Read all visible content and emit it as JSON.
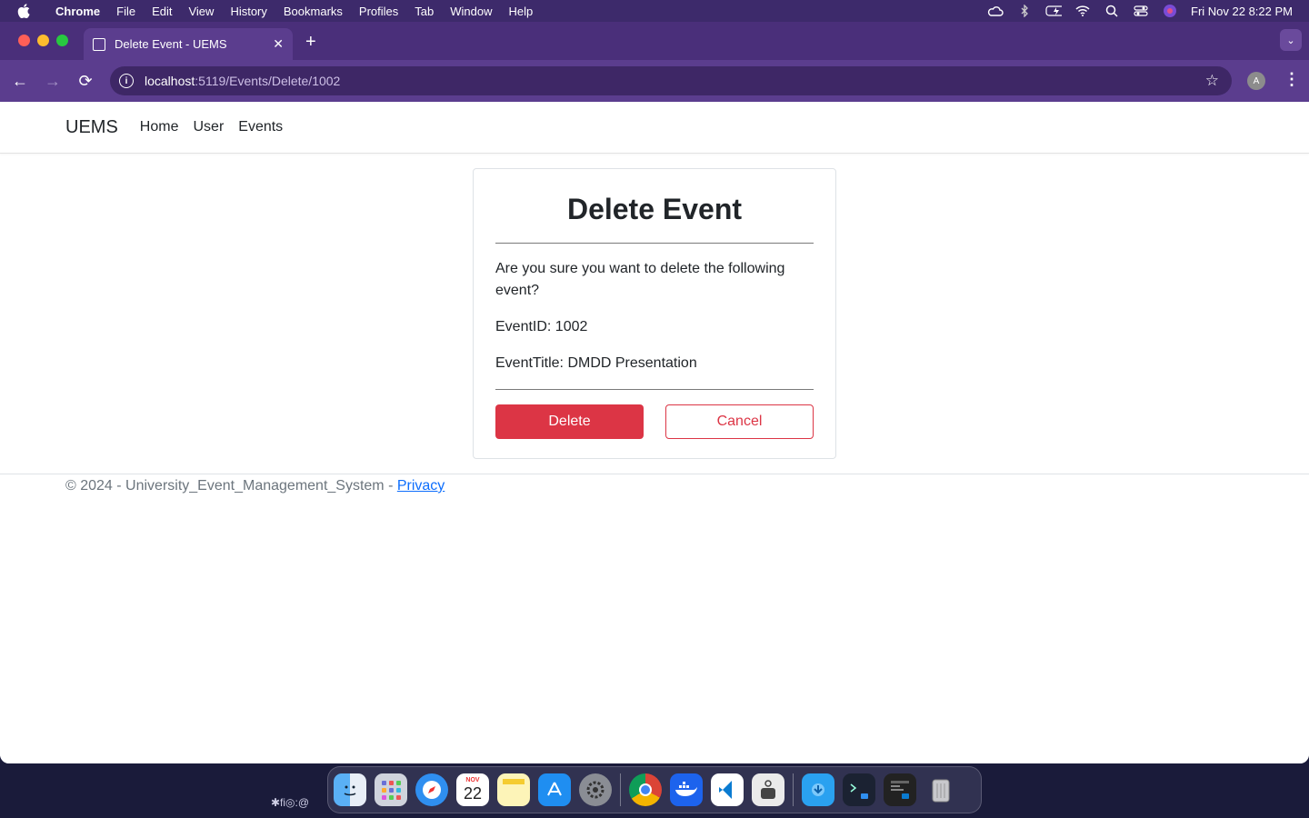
{
  "menubar": {
    "app": "Chrome",
    "items": [
      "File",
      "Edit",
      "View",
      "History",
      "Bookmarks",
      "Profiles",
      "Tab",
      "Window",
      "Help"
    ],
    "clock": "Fri Nov 22  8:22 PM"
  },
  "browser": {
    "tab_title": "Delete Event - UEMS",
    "url_host": "localhost",
    "url_path": ":5119/Events/Delete/1002",
    "avatar_letter": "A"
  },
  "site": {
    "brand": "UEMS",
    "nav": [
      "Home",
      "User",
      "Events"
    ]
  },
  "card": {
    "title": "Delete Event",
    "question": "Are you sure you want to delete the following event?",
    "event_id": "EventID: 1002",
    "event_title": "EventTitle: DMDD Presentation",
    "delete_label": "Delete",
    "cancel_label": "Cancel"
  },
  "footer": {
    "text": "© 2024 - University_Event_Management_System - ",
    "privacy": "Privacy"
  },
  "dock": {
    "calendar_month": "NOV",
    "calendar_day": "22",
    "icons": [
      "finder-icon",
      "launchpad-icon",
      "safari-icon",
      "calendar-icon",
      "notes-icon",
      "app-store-icon",
      "system-settings-icon",
      "chrome-icon",
      "docker-icon",
      "vscode-icon",
      "preview-icon",
      "downloads-icon",
      "terminal-icon",
      "window-icon",
      "trash-icon"
    ]
  },
  "colors": {
    "danger": "#dc3545",
    "browser_frame": "#5b3d8e",
    "link": "#0d6efd"
  }
}
